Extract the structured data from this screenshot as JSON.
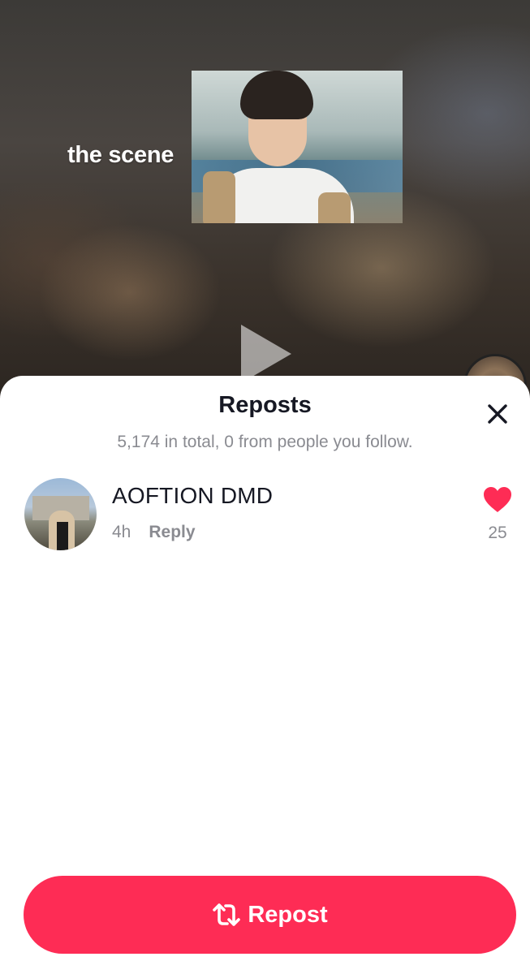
{
  "video": {
    "caption": "the scene"
  },
  "sheet": {
    "title": "Reposts",
    "subtitle": "5,174 in total, 0 from people you follow."
  },
  "reposts": [
    {
      "username": "AOFTION DMD",
      "time": "4h",
      "reply_label": "Reply",
      "likes": "25"
    }
  ],
  "icons": {
    "close": "close-icon",
    "heart": "heart-icon",
    "repost": "repost-icon",
    "play": "play-icon"
  },
  "colors": {
    "accent": "#fe2c55",
    "text_primary": "#161823",
    "text_secondary": "#8a8b91"
  },
  "footer": {
    "repost_label": "Repost"
  }
}
